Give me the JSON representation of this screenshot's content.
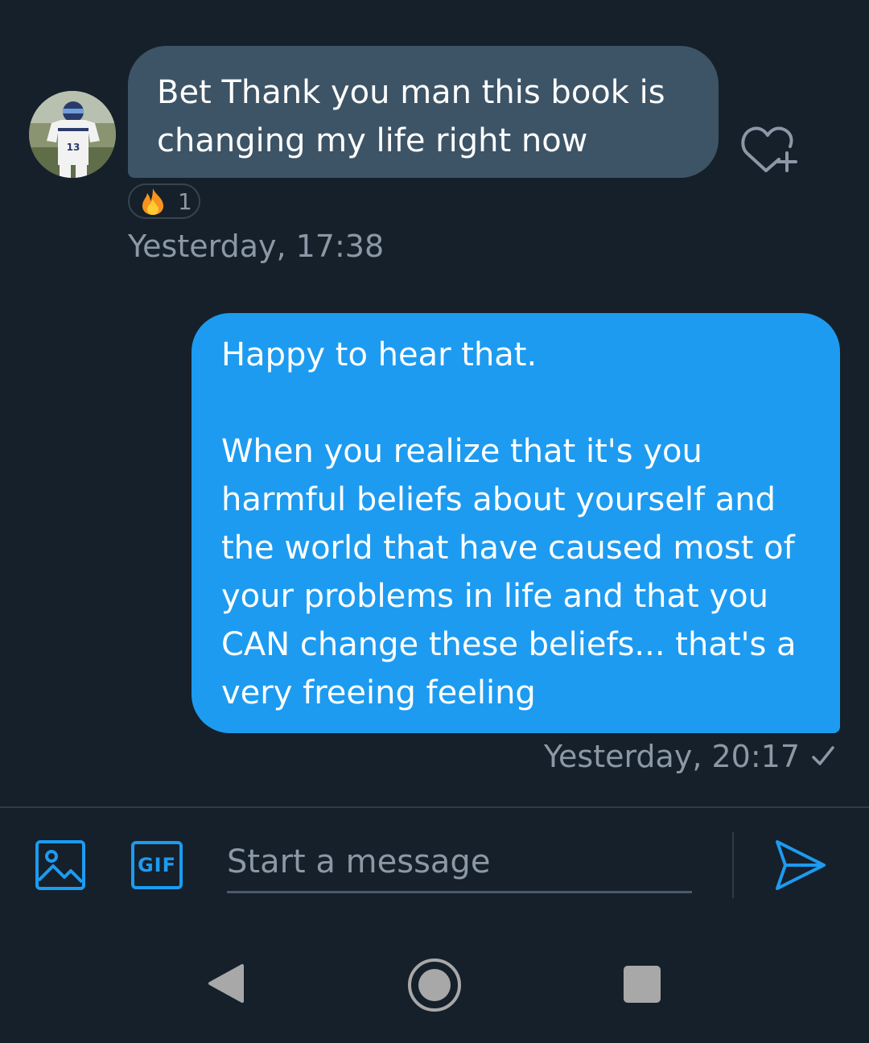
{
  "conversation": {
    "incoming": {
      "lines": [
        "Bet Thank you man this book is",
        "changing my life right now"
      ],
      "reaction": {
        "emoji_icon": "fire-icon",
        "count": "1"
      },
      "timestamp": "Yesterday, 17:38"
    },
    "outgoing": {
      "paragraph1": "Happy to hear that.",
      "lines": [
        "When you realize that it's you",
        "harmful beliefs about yourself and",
        "the world that have caused most of",
        "your problems in life and that you",
        "CAN change these beliefs... that's a",
        "very freeing feeling"
      ],
      "timestamp": "Yesterday, 20:17",
      "status_icon": "checkmark-icon"
    }
  },
  "composer": {
    "gif_label": "GIF",
    "placeholder": "Start a message"
  },
  "avatar": {
    "jersey_number": "13"
  },
  "colors": {
    "background": "#15202b",
    "incoming_bubble": "#3d5466",
    "outgoing_bubble": "#1d9bf0",
    "accent": "#1d9bf0",
    "secondary_text": "#8b98a5"
  }
}
